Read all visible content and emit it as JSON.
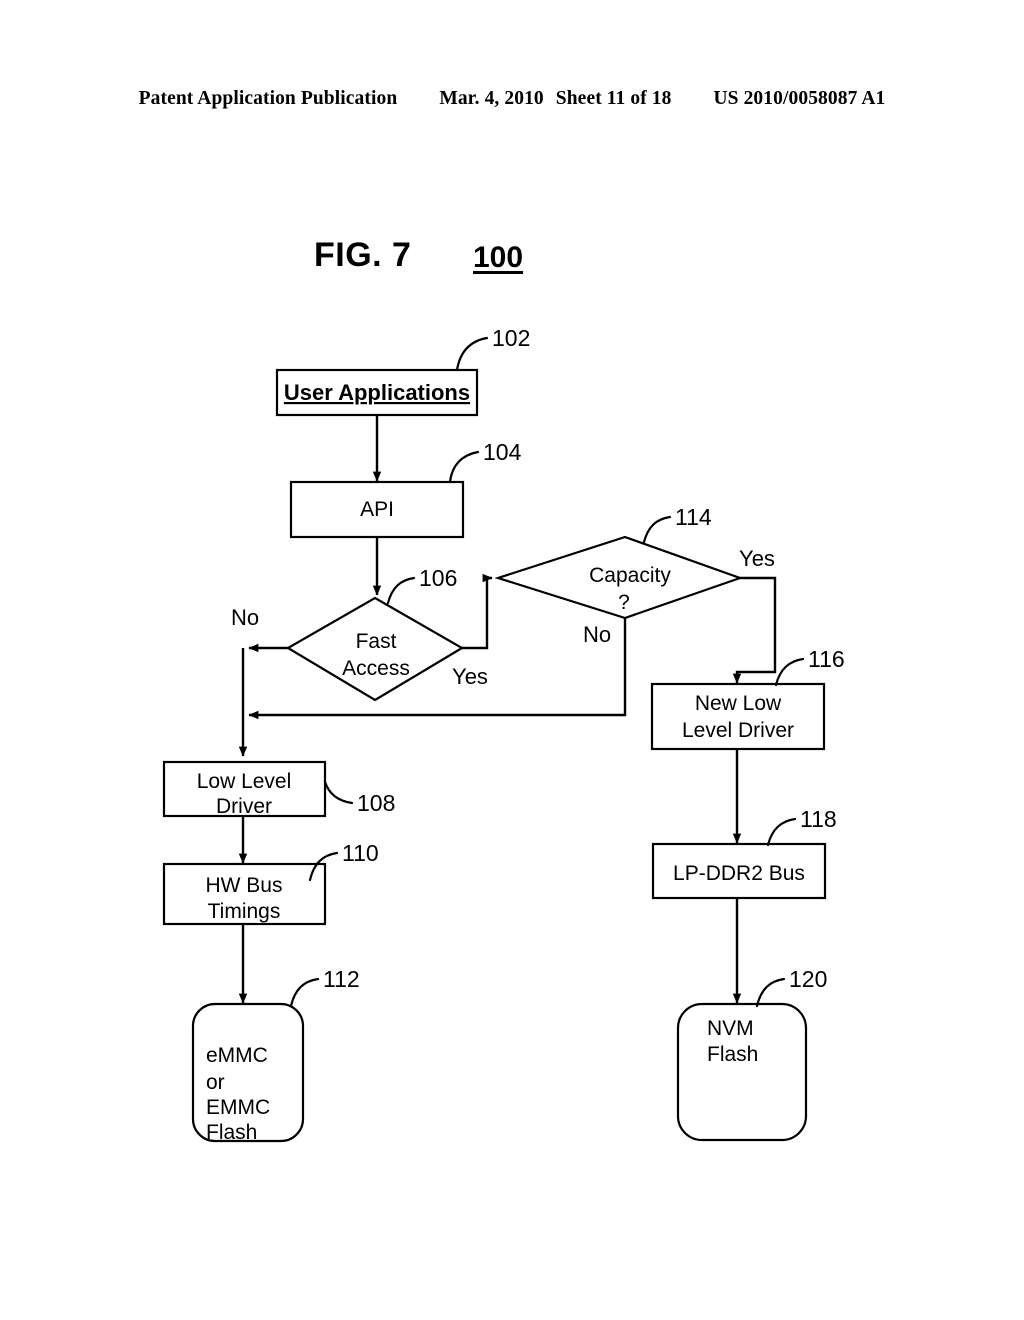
{
  "header": {
    "publication": "Patent Application Publication",
    "date": "Mar. 4, 2010",
    "sheet": "Sheet 11 of 18",
    "number": "US 2010/0058087 A1"
  },
  "figure": {
    "title": "FIG. 7",
    "ref": "100"
  },
  "nodes": {
    "user_applications": {
      "label": "User Applications",
      "ref": "102"
    },
    "api": {
      "label": "API",
      "ref": "104"
    },
    "fast_access": {
      "line1": "Fast",
      "line2": "Access",
      "ref": "106"
    },
    "low_level_driver": {
      "line1": "Low Level",
      "line2": "Driver",
      "ref": "108"
    },
    "hw_bus_timings": {
      "line1": "HW Bus",
      "line2": "Timings",
      "ref": "110"
    },
    "emmc_flash": {
      "line1": "eMMC",
      "line2": "or",
      "line3": "EMMC",
      "line4": "Flash",
      "ref": "112"
    },
    "capacity": {
      "line1": "Capacity",
      "line2": "?",
      "ref": "114"
    },
    "new_low_level_driver": {
      "line1": "New Low",
      "line2": "Level Driver",
      "ref": "116"
    },
    "lpddr2_bus": {
      "label": "LP-DDR2 Bus",
      "ref": "118"
    },
    "nvm_flash": {
      "line1": "NVM",
      "line2": "Flash",
      "ref": "120"
    }
  },
  "branches": {
    "fast_access_no": "No",
    "fast_access_yes": "Yes",
    "capacity_no": "No",
    "capacity_yes": "Yes"
  },
  "colors": {
    "ink": "#000000",
    "paper": "#ffffff"
  }
}
